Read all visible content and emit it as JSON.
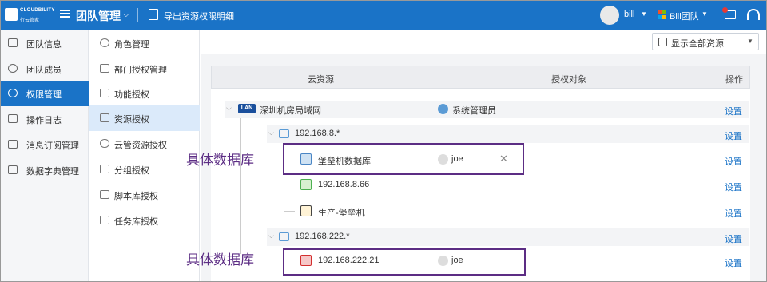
{
  "header": {
    "logo_text": "CLOUDBILITY",
    "logo_sub": "行云管家",
    "app_title": "团队管理",
    "export_label": "导出资源权限明细",
    "user_name": "bill",
    "team_name": "Bill团队"
  },
  "sidebar1": {
    "items": [
      {
        "label": "团队信息",
        "icon": "info-icon"
      },
      {
        "label": "团队成员",
        "icon": "members-icon"
      },
      {
        "label": "权限管理",
        "icon": "permission-icon",
        "active": true
      },
      {
        "label": "操作日志",
        "icon": "log-icon"
      },
      {
        "label": "消息订阅管理",
        "icon": "mail-icon"
      },
      {
        "label": "数据字典管理",
        "icon": "dictionary-icon"
      }
    ]
  },
  "sidebar2": {
    "items": [
      {
        "label": "角色管理",
        "icon": "role-icon"
      },
      {
        "label": "部门授权管理",
        "icon": "department-icon"
      },
      {
        "label": "功能授权",
        "icon": "function-icon"
      },
      {
        "label": "资源授权",
        "icon": "monitor-icon",
        "active": true
      },
      {
        "label": "云管资源授权",
        "icon": "cloud-icon"
      },
      {
        "label": "分组授权",
        "icon": "folder-icon"
      },
      {
        "label": "脚本库授权",
        "icon": "script-icon"
      },
      {
        "label": "任务库授权",
        "icon": "task-icon"
      }
    ]
  },
  "filter": {
    "label": "显示全部资源"
  },
  "table": {
    "headers": [
      "云资源",
      "授权对象",
      "操作"
    ],
    "rows": [
      {
        "resource": "深圳机房局域网",
        "badge": "LAN",
        "grantee": "系统管理员",
        "action": "设置"
      },
      {
        "resource": "192.168.8.*",
        "grantee": "",
        "action": "设置"
      },
      {
        "resource": "堡垒机数据库",
        "grantee": "joe",
        "action": "设置"
      },
      {
        "resource": "192.168.8.66",
        "grantee": "",
        "action": "设置"
      },
      {
        "resource": "生产-堡垒机",
        "grantee": "",
        "action": "设置"
      },
      {
        "resource": "192.168.222.*",
        "grantee": "",
        "action": "设置"
      },
      {
        "resource": "192.168.222.21",
        "grantee": "joe",
        "action": "设置"
      }
    ]
  },
  "annotations": [
    "具体数据库",
    "具体数据库"
  ],
  "colors": {
    "brand": "#1a73c7",
    "annotation": "#5c2d84",
    "active_sub": "#dbeafa"
  }
}
